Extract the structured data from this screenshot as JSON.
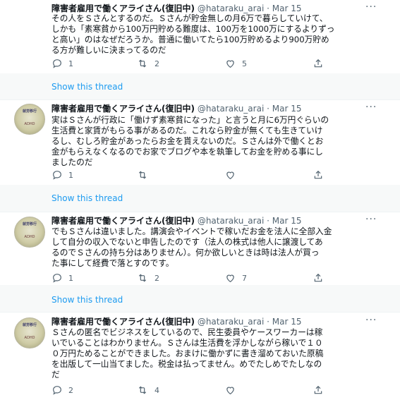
{
  "tweets": [
    {
      "name": "障害者雇用で働くアライさん(復旧中)",
      "handle": "@hataraku_arai",
      "date": "Mar 15",
      "avatar_text": "ADHD",
      "text": [
        "その人をＳさんとするのだ。Ｓさんが貯金無しの月6万で暮らしていけて、",
        "しかも「素寒貧から100万円貯める難度は、100万を1000万にするよりずっ",
        "と高い」のはなぜだろうか。普通に働いてたら100万貯めるより900万貯め",
        "る方が難しいに決まってるのだ"
      ],
      "reply_count": "1",
      "retweet_count": "2",
      "like_count": "5",
      "show_thread": "Show this thread"
    },
    {
      "name": "障害者雇用で働くアライさん(復旧中)",
      "handle": "@hataraku_arai",
      "date": "Mar 15",
      "avatar_text": "ADHD",
      "text": [
        "実はＳさんが行政に「働けず素寒貧になった」と言うと月に6万円ぐらいの",
        "生活費と家賃がもらる事があるのだ。これなら貯金が無くても生きていけ",
        "るし、むしろ貯金があったらお金を貰えないのだ。Ｓさんは外で働くとお",
        "金がもらえなくなるのでお家でブログや本を執筆してお金を貯める事にし",
        "ましたのだ"
      ],
      "reply_count": "1",
      "retweet_count": "",
      "like_count": "",
      "show_thread": "Show this thread"
    },
    {
      "name": "障害者雇用で働くアライさん(復旧中)",
      "handle": "@hataraku_arai",
      "date": "Mar 15",
      "avatar_text": "ADHD",
      "text": [
        "でもＳさんは違いました。講演会やイベントで稼いだお金を法人に全部入金",
        "して自分の収入でないと申告したのです（法人の株式は他人に譲渡してあ",
        "るのでＳさんの持ち分はありません）。何か欲しいときは時は法人が買っ",
        "た事にして経費で落とすのです。"
      ],
      "reply_count": "1",
      "retweet_count": "2",
      "like_count": "7",
      "show_thread": "Show this thread"
    },
    {
      "name": "障害者雇用で働くアライさん(復旧中)",
      "handle": "@hataraku_arai",
      "date": "Mar 15",
      "avatar_text": "ADHD",
      "text": [
        "Ｓさんの匿名でビジネスをしているので、民生委員やケースワーカーは稼",
        "いでいることはわかりません。Ｓさんは生活費を浮かしながら稼いで１０",
        "０万円ためることができました。おまけに働かずに書き溜めておいた原稿",
        "を出版して一山当てました。税金は払ってません。めでたしめでたしなの",
        "だ"
      ],
      "reply_count": "2",
      "retweet_count": "4",
      "like_count": "",
      "show_thread": ""
    }
  ],
  "colors": {
    "link": "#1d9bf0",
    "meta": "#536471",
    "text": "#0f1419"
  }
}
